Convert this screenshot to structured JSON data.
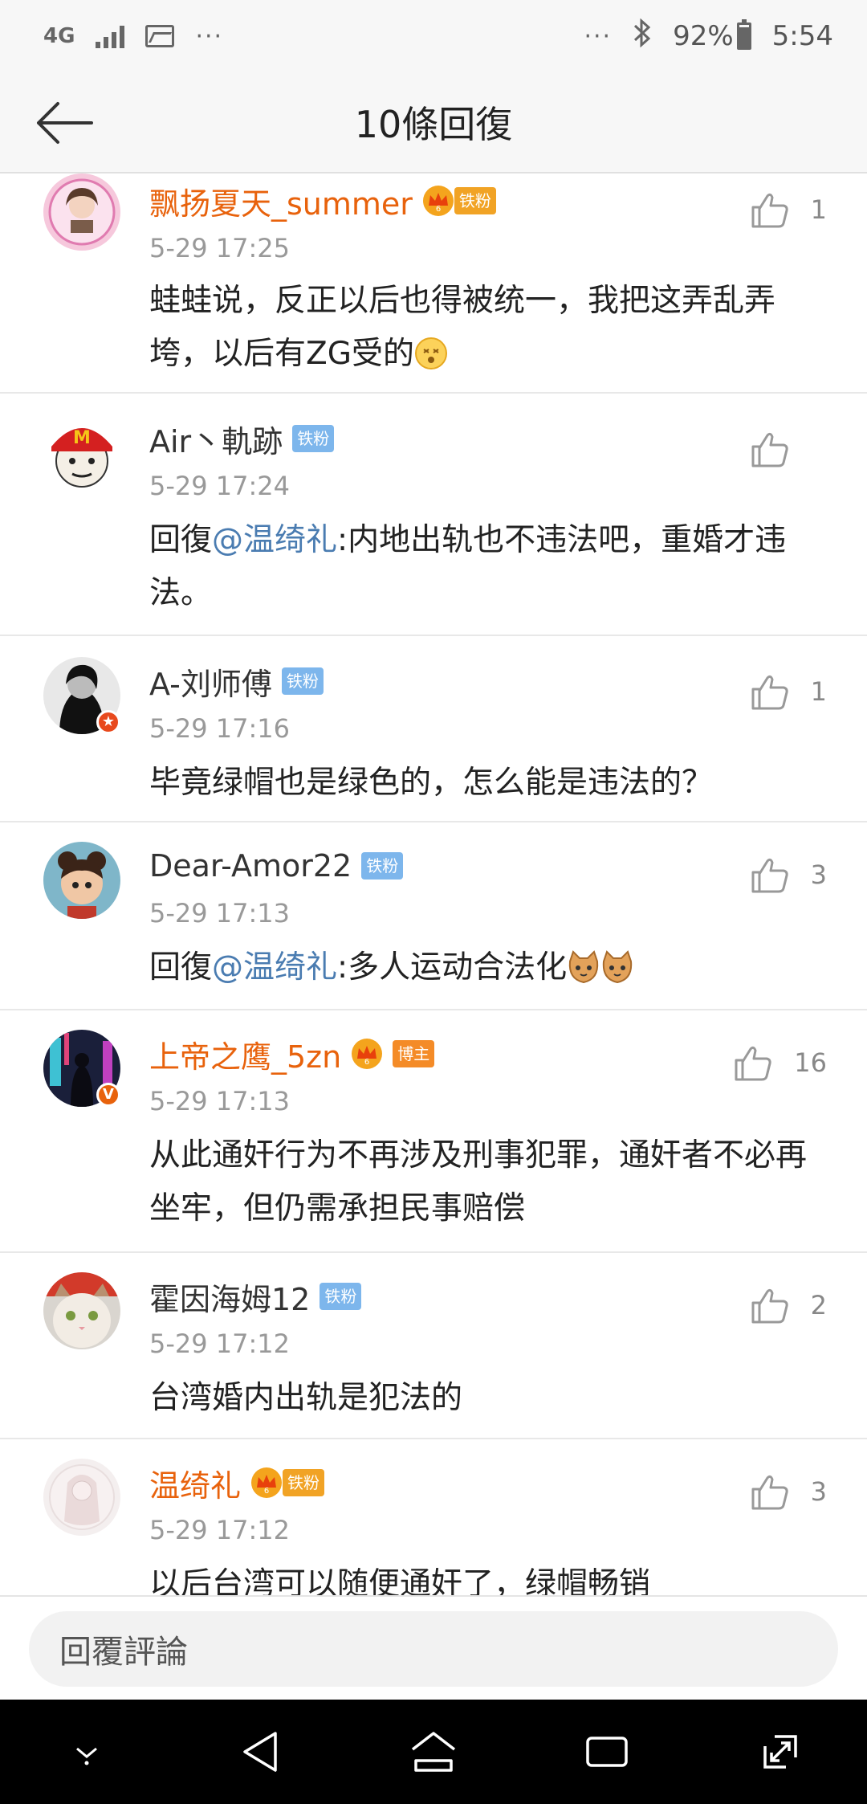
{
  "status_bar": {
    "network": "4G",
    "more": "···",
    "more_right": "···",
    "battery": "92%",
    "time": "5:54"
  },
  "header": {
    "title": "10條回復"
  },
  "comments": [
    {
      "username": "飘扬夏天_summer",
      "badge": "铁粉",
      "time": "5-29 17:25",
      "text": "蛙蛙说，反正以后也得被统一，我把这弄乱弄垮，以后有ZG受的",
      "likes": "1"
    },
    {
      "username": "Air丶軌跡",
      "badge": "铁粉",
      "time": "5-29 17:24",
      "reply_prefix": "回復",
      "mention": "@温绮礼",
      "text": ":内地出轨也不违法吧，重婚才违法。",
      "likes": ""
    },
    {
      "username": "A-刘师傅",
      "badge": "铁粉",
      "time": "5-29 17:16",
      "text": "毕竟绿帽也是绿色的，怎么能是违法的？",
      "likes": "1"
    },
    {
      "username": "Dear-Amor22",
      "badge": "铁粉",
      "time": "5-29 17:13",
      "reply_prefix": "回復",
      "mention": "@温绮礼",
      "text": ":多人运动合法化",
      "likes": "3"
    },
    {
      "username": "上帝之鹰_5zn",
      "badge": "博主",
      "time": "5-29 17:13",
      "text": "从此通奸行为不再涉及刑事犯罪，通奸者不必再坐牢，但仍需承担民事赔偿",
      "likes": "16"
    },
    {
      "username": "霍因海姆12",
      "badge": "铁粉",
      "time": "5-29 17:12",
      "text": "台湾婚内出轨是犯法的",
      "likes": "2"
    },
    {
      "username": "温绮礼",
      "badge": "铁粉",
      "time": "5-29 17:12",
      "text": "以后台湾可以随便通奸了，绿帽畅销",
      "likes": "3"
    }
  ],
  "reply_bar": {
    "placeholder": "回覆評論"
  },
  "colors": {
    "vip_name": "#e8620c",
    "mention": "#4a7cb1",
    "fan_tag": "#7db6ec",
    "host_tag": "#f48b27"
  }
}
